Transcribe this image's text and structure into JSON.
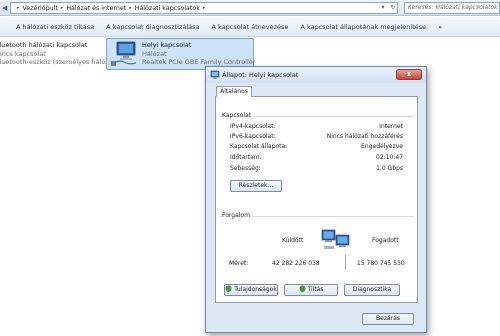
{
  "address_bar": {
    "crumbs": [
      "Vezérlőpult",
      "Hálózat és internet",
      "Hálózati kapcsolatok"
    ],
    "search_placeholder": "Keresés: Hálózati kapcsolatok"
  },
  "command_bar": {
    "items": [
      "A hálózati eszköz tiltása",
      "A kapcsolat diagnosztizálása",
      "A kapcsolat átnevezése",
      "A kapcsolat állapotának megjelenítése"
    ],
    "more": "»"
  },
  "connections": [
    {
      "name": "Bluetooth hálózati kapcsolat",
      "status": "Nincs kapcsolat",
      "device": "Bluetooth-eszköz (személyes hálózat)"
    },
    {
      "name": "Helyi kapcsolat",
      "status": "Hálózat",
      "device": "Realtek PCIe GBE Family Controller"
    }
  ],
  "dialog": {
    "title": "Állapot: Helyi kapcsolat",
    "close": "x",
    "tab": "Általános",
    "connection_group": "Kapcsolat",
    "rows": [
      {
        "key": "IPv4-kapcsolat:",
        "value": "Internet"
      },
      {
        "key": "IPv6-kapcsolat:",
        "value": "Nincs hálózati hozzáférés"
      },
      {
        "key": "Kapcsolat állapota:",
        "value": "Engedélyezve"
      },
      {
        "key": "Időtartam:",
        "value": "02:10:47"
      },
      {
        "key": "Sebesség:",
        "value": "1,0 Gbps"
      }
    ],
    "details_button": "Részletek...",
    "activity_group": "Forgalom",
    "sent_label": "Küldött",
    "received_label": "Fogadott",
    "bytes_label": "Méret:",
    "bytes_sent": "42 282 226 038",
    "bytes_received": "15 780 745 530",
    "properties_button": "Tulajdonságok",
    "disable_button": "Tiltás",
    "diagnose_button": "Diagnosztika",
    "close_button": "Bezárás"
  }
}
